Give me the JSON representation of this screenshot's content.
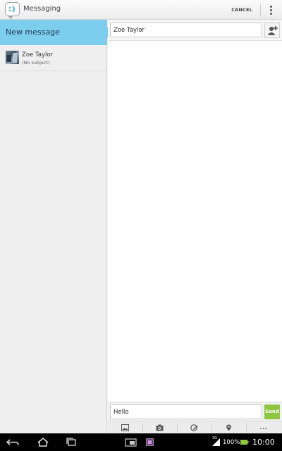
{
  "actionbar": {
    "title": "Messaging",
    "cancel_label": "CANCEL",
    "icons": {
      "app": "messaging-app-icon",
      "overflow": "overflow-menu-icon"
    }
  },
  "left_pane": {
    "new_message_label": "New message",
    "conversations": [
      {
        "name": "Zoe Taylor",
        "subject": "(No subject)"
      }
    ]
  },
  "compose": {
    "recipient_value": "Zoe Taylor",
    "message_value": "Hello",
    "send_label": "Send"
  },
  "attachments": [
    {
      "icon": "picture-icon"
    },
    {
      "icon": "camera-icon"
    },
    {
      "icon": "sketch-icon"
    },
    {
      "icon": "location-pin-icon"
    },
    {
      "icon": "more-icon"
    }
  ],
  "system_bar": {
    "battery_percent": "100%",
    "network_label": "3G",
    "time": "10:00"
  },
  "colors": {
    "selected_item": "#7dcdef",
    "send_button": "#8ec63f",
    "battery": "#8ec63f"
  }
}
